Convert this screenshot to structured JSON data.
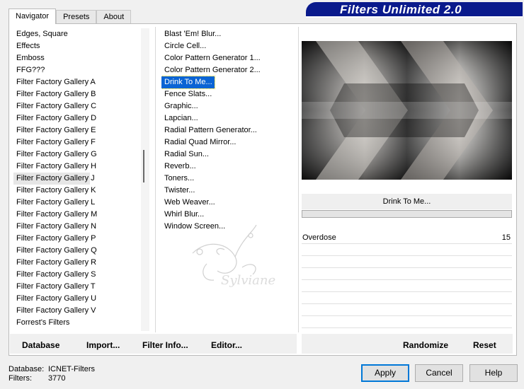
{
  "window": {
    "title": "Filters Unlimited 2.0",
    "colors": {
      "banner": "#0a1a8c",
      "selection": "#0a64d4"
    }
  },
  "tabs": [
    {
      "label": "Navigator",
      "active": true
    },
    {
      "label": "Presets",
      "active": false
    },
    {
      "label": "About",
      "active": false
    }
  ],
  "categories": {
    "items": [
      "Edges, Square",
      "Effects",
      "Emboss",
      "FFG???",
      "Filter Factory Gallery A",
      "Filter Factory Gallery B",
      "Filter Factory Gallery C",
      "Filter Factory Gallery D",
      "Filter Factory Gallery E",
      "Filter Factory Gallery F",
      "Filter Factory Gallery G",
      "Filter Factory Gallery H",
      "Filter Factory Gallery J",
      "Filter Factory Gallery K",
      "Filter Factory Gallery L",
      "Filter Factory Gallery M",
      "Filter Factory Gallery N",
      "Filter Factory Gallery P",
      "Filter Factory Gallery Q",
      "Filter Factory Gallery R",
      "Filter Factory Gallery S",
      "Filter Factory Gallery T",
      "Filter Factory Gallery U",
      "Filter Factory Gallery V",
      "Forrest's Filters"
    ],
    "hovered": "Filter Factory Gallery J"
  },
  "filters": {
    "items": [
      "Blast 'Em! Blur...",
      "Circle Cell...",
      "Color Pattern Generator 1...",
      "Color Pattern Generator 2...",
      "Drink To Me...",
      "Fence Slats...",
      "Graphic...",
      "Lapcian...",
      "Radial Pattern Generator...",
      "Radial Quad Mirror...",
      "Radial Sun...",
      "Reverb...",
      "Toners...",
      "Twister...",
      "Web Weaver...",
      "Whirl Blur...",
      "Window Screen..."
    ],
    "selected": "Drink To Me..."
  },
  "preview": {
    "filter_name": "Drink To Me...",
    "progress": 0
  },
  "parameters": [
    {
      "name": "Overdose",
      "value": "15"
    }
  ],
  "watermark": {
    "text": "Sylviane"
  },
  "toolbar": {
    "database": "Database",
    "import": "Import...",
    "filter_info": "Filter Info...",
    "editor": "Editor...",
    "randomize": "Randomize",
    "reset": "Reset"
  },
  "footer": {
    "database_label": "Database:",
    "database_value": "ICNET-Filters",
    "filters_label": "Filters:",
    "filters_value": "3770"
  },
  "buttons": {
    "apply": "Apply",
    "cancel": "Cancel",
    "help": "Help"
  }
}
